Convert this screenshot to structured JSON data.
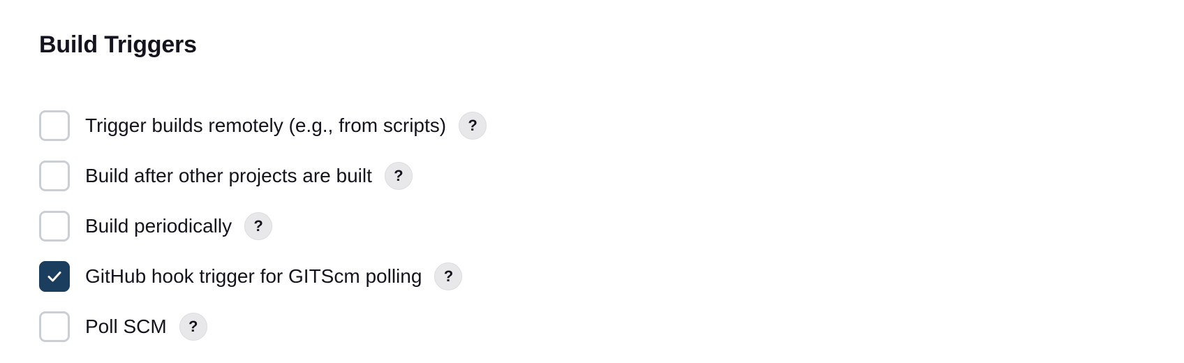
{
  "section": {
    "title": "Build Triggers"
  },
  "triggers": [
    {
      "label": "Trigger builds remotely (e.g., from scripts)",
      "checked": false,
      "help": "?"
    },
    {
      "label": "Build after other projects are built",
      "checked": false,
      "help": "?"
    },
    {
      "label": "Build periodically",
      "checked": false,
      "help": "?"
    },
    {
      "label": "GitHub hook trigger for GITScm polling",
      "checked": true,
      "help": "?"
    },
    {
      "label": "Poll SCM",
      "checked": false,
      "help": "?"
    }
  ],
  "icons": {
    "checkbox_checked": "check-icon",
    "help": "question-mark-icon"
  },
  "colors": {
    "checked_fill": "#1b3e5f",
    "unchecked_border": "#c9cfd5",
    "help_bg": "#e8e8ea",
    "text": "#14141f"
  }
}
